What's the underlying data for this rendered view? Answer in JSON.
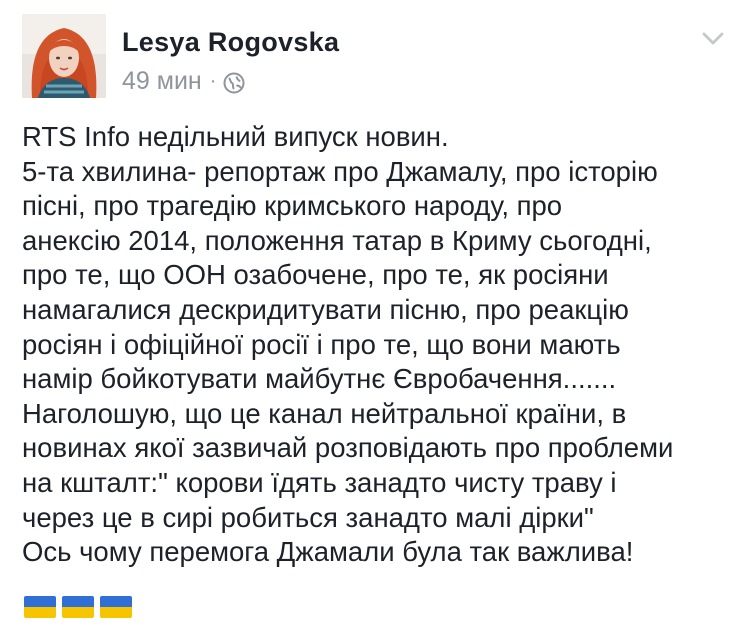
{
  "post": {
    "author": "Lesya Rogovska",
    "time": "49 мин",
    "separator": "·",
    "privacy_icon": "globe-icon",
    "menu_icon": "chevron-down-icon",
    "avatar_icon": "profile-photo",
    "lines": [
      "RTS Info недільний випуск новин.",
      "5-та хвилина-  репортаж про Джамалу, про історію",
      "пісні, про трагедію кримського народу, про",
      "анексію 2014, положення татар в Криму сьогодні,",
      "про те, що ООН озабочене, про те, як росіяни",
      "намагалися дескридитувати пісню, про реакцію",
      "росіян і офіційної росії і про те, що вони мають",
      "намір бойкотувати майбутнє Євробачення.......",
      "Наголошую, що це канал нейтральної країни, в",
      "новинах якої зазвичай розповідають про проблеми",
      "на кшталт:\" корови їдять занадто чисту траву і",
      "через це в сирі робиться занадто малі дірки\"",
      "Ось чому перемога Джамали була так важлива!"
    ],
    "flags": [
      {
        "icon": "ukraine-flag-icon",
        "top_color": "#2f6fd6",
        "bottom_color": "#f6c500"
      },
      {
        "icon": "ukraine-flag-icon",
        "top_color": "#2f6fd6",
        "bottom_color": "#f6c500"
      },
      {
        "icon": "ukraine-flag-icon",
        "top_color": "#2f6fd6",
        "bottom_color": "#f6c500"
      }
    ]
  },
  "colors": {
    "name": "#1d2129",
    "meta": "#90949c",
    "text": "#1d2129"
  }
}
